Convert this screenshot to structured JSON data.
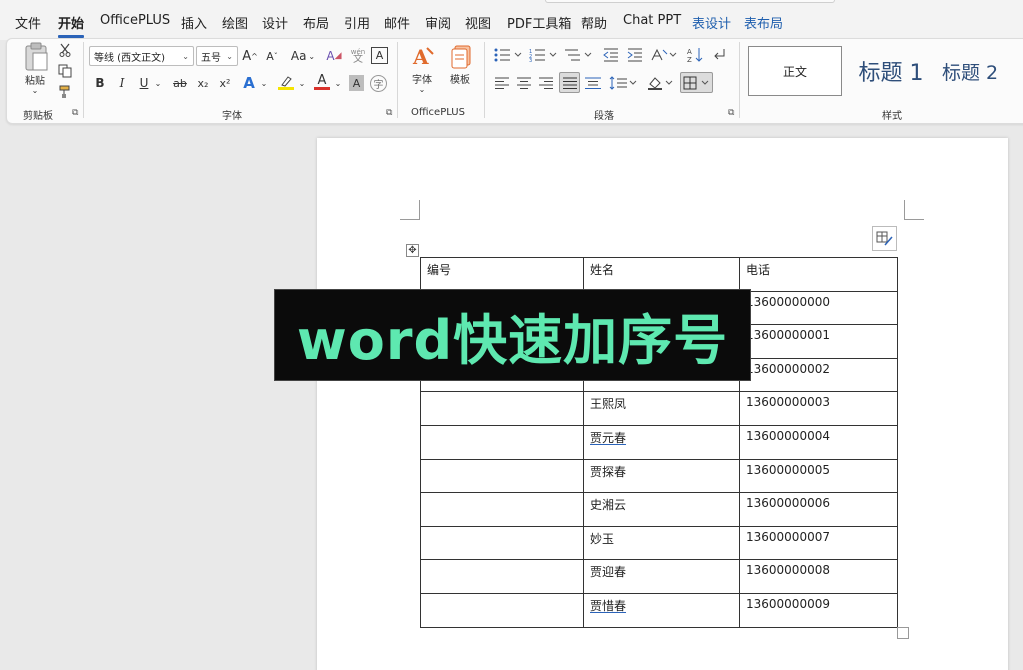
{
  "menu": {
    "file": "文件",
    "home": "开始",
    "officeplus": "OfficePLUS",
    "insert": "插入",
    "draw": "绘图",
    "design": "设计",
    "layout": "布局",
    "references": "引用",
    "mailings": "邮件",
    "review": "审阅",
    "view": "视图",
    "pdf": "PDF工具箱",
    "help": "帮助",
    "chatppt": "Chat PPT",
    "table_design": "表设计",
    "table_layout": "表布局"
  },
  "ribbon": {
    "clipboard": {
      "label": "剪贴板",
      "paste": "粘贴"
    },
    "font": {
      "label": "字体",
      "font_name": "等线 (西文正文)",
      "font_size": "五号",
      "change_case": "Aa",
      "bold": "B",
      "italic": "I",
      "underline": "U",
      "strike": "ab",
      "subscript": "x₂",
      "superscript": "x²",
      "grow": "A",
      "shrink": "A",
      "text_effect": "A",
      "font_color": "A",
      "char_shading": "A",
      "clear_format": "A",
      "phonetic": "wén",
      "char_border": "A"
    },
    "officeplus_group": {
      "label": "OfficePLUS",
      "font_btn": "字体",
      "template_btn": "模板"
    },
    "paragraph": {
      "label": "段落"
    },
    "styles": {
      "label": "样式",
      "normal": "正文",
      "heading1": "标题 1",
      "heading2": "标题 2"
    }
  },
  "colors": {
    "accent": "#2b63b8",
    "highlight_yellow": "#f5e400",
    "font_red": "#d9322b",
    "overlay_text": "#5ee8b0",
    "overlay_bg": "#0b0b0b"
  },
  "overlay": {
    "caption": "word快速加序号"
  },
  "table": {
    "headers": [
      "编号",
      "姓名",
      "电话"
    ],
    "rows": [
      [
        "",
        "",
        "13600000000"
      ],
      [
        "",
        "",
        "13600000001"
      ],
      [
        "",
        "",
        "13600000002"
      ],
      [
        "",
        "王熙凤",
        "13600000003"
      ],
      [
        "",
        "贾元春",
        "13600000004"
      ],
      [
        "",
        "贾探春",
        "13600000005"
      ],
      [
        "",
        "史湘云",
        "13600000006"
      ],
      [
        "",
        "妙玉",
        "13600000007"
      ],
      [
        "",
        "贾迎春",
        "13600000008"
      ],
      [
        "",
        "贾惜春",
        "13600000009"
      ]
    ]
  }
}
